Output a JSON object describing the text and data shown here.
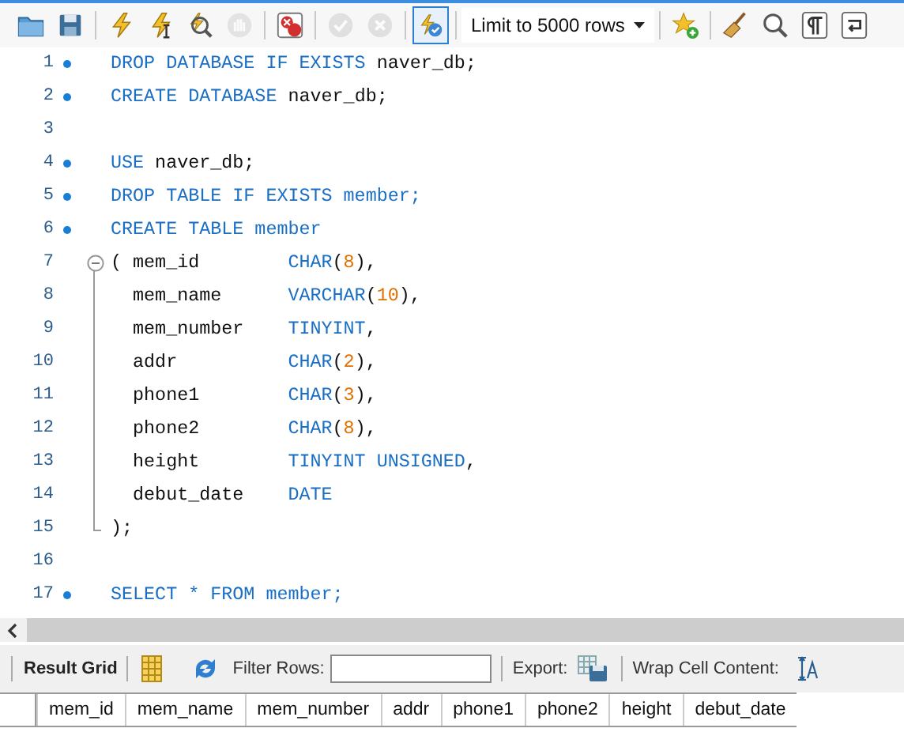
{
  "toolbar": {
    "buttons": [
      {
        "disabled": false,
        "selected": false
      },
      {
        "disabled": false,
        "selected": false
      },
      {
        "disabled": false,
        "selected": false
      },
      {
        "disabled": false,
        "selected": false
      },
      {
        "disabled": false,
        "selected": false
      },
      {
        "disabled": true,
        "selected": false
      },
      {
        "disabled": false,
        "selected": false
      },
      {
        "disabled": true,
        "selected": false
      },
      {
        "disabled": true,
        "selected": false
      },
      {
        "disabled": false,
        "selected": true
      }
    ],
    "limit": {
      "value": "Limit to 5000 rows"
    },
    "tools": [
      {
        "disabled": false
      },
      {
        "disabled": false
      },
      {
        "disabled": false
      },
      {
        "disabled": false
      },
      {
        "disabled": false
      }
    ]
  },
  "editor": {
    "lines": [
      {
        "number": "1",
        "marker": true,
        "tokens": [
          {
            "text": "DROP DATABASE IF EXISTS",
            "kind": "keyword"
          },
          {
            "text": " naver_db;",
            "kind": "plain"
          }
        ]
      },
      {
        "number": "2",
        "marker": true,
        "tokens": [
          {
            "text": "CREATE DATABASE",
            "kind": "keyword"
          },
          {
            "text": " naver_db;",
            "kind": "plain"
          }
        ]
      },
      {
        "number": "3",
        "marker": false
      },
      {
        "number": "4",
        "marker": true,
        "tokens": [
          {
            "text": "USE",
            "kind": "keyword"
          },
          {
            "text": " naver_db;",
            "kind": "plain"
          }
        ]
      },
      {
        "number": "5",
        "marker": true,
        "tokens": [
          {
            "text": "DROP TABLE IF EXISTS member;",
            "kind": "keyword"
          }
        ]
      },
      {
        "number": "6",
        "marker": true,
        "tokens": [
          {
            "text": "CREATE TABLE member",
            "kind": "keyword"
          }
        ]
      },
      {
        "number": "7",
        "marker": false,
        "fold_open": true,
        "tokens": [
          {
            "text": "( mem_id        ",
            "kind": "plain"
          },
          {
            "text": "CHAR",
            "kind": "keyword"
          },
          {
            "text": "(",
            "kind": "plain"
          },
          {
            "text": "8",
            "kind": "number"
          },
          {
            "text": "),",
            "kind": "plain"
          }
        ]
      },
      {
        "number": "8",
        "marker": false,
        "in_fold": true,
        "tokens": [
          {
            "text": "  mem_name      ",
            "kind": "plain"
          },
          {
            "text": "VARCHAR",
            "kind": "keyword"
          },
          {
            "text": "(",
            "kind": "plain"
          },
          {
            "text": "10",
            "kind": "number"
          },
          {
            "text": "),",
            "kind": "plain"
          }
        ]
      },
      {
        "number": "9",
        "marker": false,
        "in_fold": true,
        "tokens": [
          {
            "text": "  mem_number    ",
            "kind": "plain"
          },
          {
            "text": "TINYINT",
            "kind": "keyword"
          },
          {
            "text": ",",
            "kind": "plain"
          }
        ]
      },
      {
        "number": "10",
        "marker": false,
        "in_fold": true,
        "tokens": [
          {
            "text": "  addr          ",
            "kind": "plain"
          },
          {
            "text": "CHAR",
            "kind": "keyword"
          },
          {
            "text": "(",
            "kind": "plain"
          },
          {
            "text": "2",
            "kind": "number"
          },
          {
            "text": "),",
            "kind": "plain"
          }
        ]
      },
      {
        "number": "11",
        "marker": false,
        "in_fold": true,
        "tokens": [
          {
            "text": "  phone1        ",
            "kind": "plain"
          },
          {
            "text": "CHAR",
            "kind": "keyword"
          },
          {
            "text": "(",
            "kind": "plain"
          },
          {
            "text": "3",
            "kind": "number"
          },
          {
            "text": "),",
            "kind": "plain"
          }
        ]
      },
      {
        "number": "12",
        "marker": false,
        "in_fold": true,
        "tokens": [
          {
            "text": "  phone2        ",
            "kind": "plain"
          },
          {
            "text": "CHAR",
            "kind": "keyword"
          },
          {
            "text": "(",
            "kind": "plain"
          },
          {
            "text": "8",
            "kind": "number"
          },
          {
            "text": "),",
            "kind": "plain"
          }
        ]
      },
      {
        "number": "13",
        "marker": false,
        "in_fold": true,
        "tokens": [
          {
            "text": "  height        ",
            "kind": "plain"
          },
          {
            "text": "TINYINT UNSIGNED",
            "kind": "keyword"
          },
          {
            "text": ",",
            "kind": "plain"
          }
        ]
      },
      {
        "number": "14",
        "marker": false,
        "in_fold": true,
        "tokens": [
          {
            "text": "  debut_date    ",
            "kind": "plain"
          },
          {
            "text": "DATE",
            "kind": "keyword"
          }
        ]
      },
      {
        "number": "15",
        "marker": false,
        "fold_end": true,
        "tokens": [
          {
            "text": ");",
            "kind": "plain"
          }
        ]
      },
      {
        "number": "16",
        "marker": false
      },
      {
        "number": "17",
        "marker": true,
        "tokens": [
          {
            "text": "SELECT * FROM member;",
            "kind": "keyword"
          }
        ]
      }
    ]
  },
  "result": {
    "tab": "Result Grid",
    "filter_label": "Filter Rows:",
    "export_label": "Export:",
    "wrap_label": "Wrap Cell Content:",
    "columns": [
      "mem_id",
      "mem_name",
      "mem_number",
      "addr",
      "phone1",
      "phone2",
      "height",
      "debut_date"
    ]
  }
}
